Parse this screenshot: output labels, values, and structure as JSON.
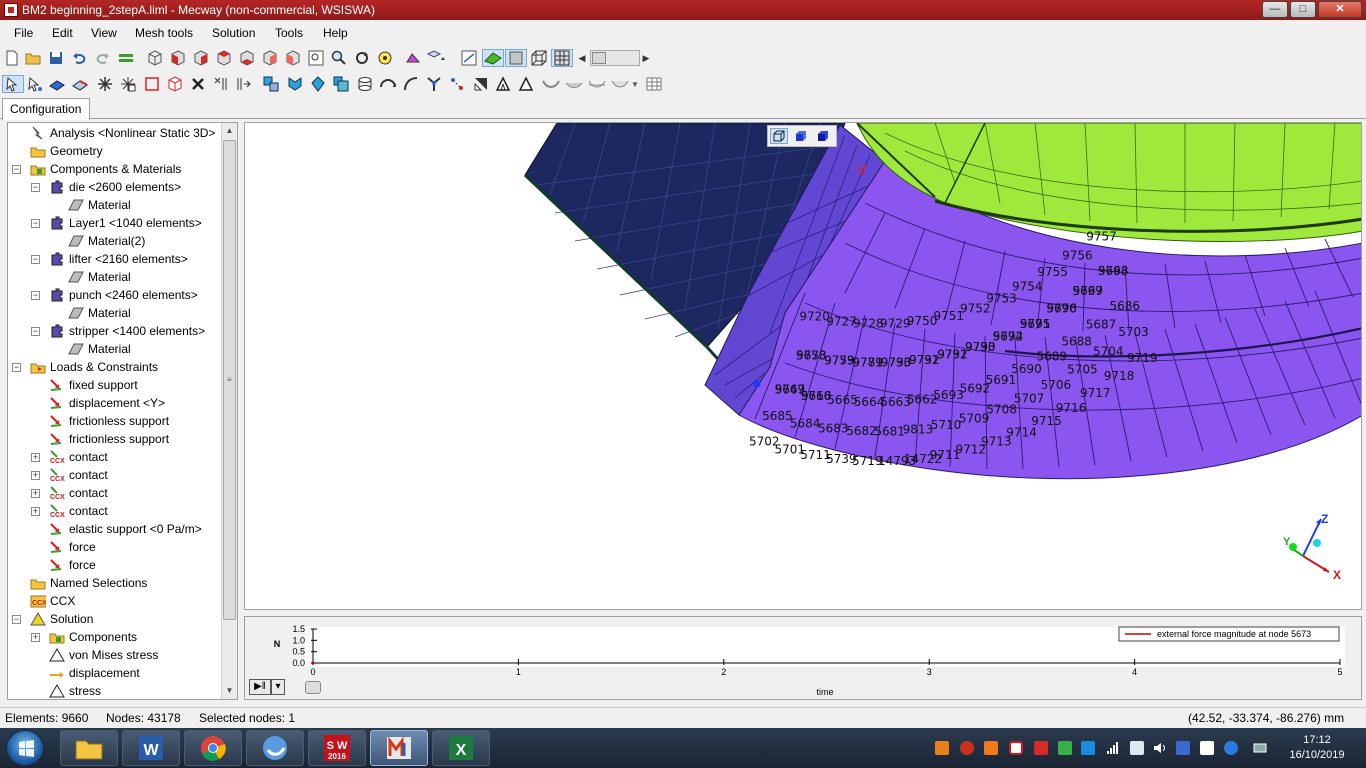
{
  "window": {
    "title": "BM2 beginning_2stepA.liml - Mecway (non-commercial, WSISWA)",
    "minimize_label": "—",
    "maximize_label": "□",
    "close_label": "✕"
  },
  "menu": [
    "File",
    "Edit",
    "View",
    "Mesh tools",
    "Solution",
    "Tools",
    "Help"
  ],
  "tabs": {
    "configuration": "Configuration"
  },
  "tree": [
    {
      "label": "Analysis <Nonlinear Static 3D>",
      "icon": "analysis-icon",
      "level": 1,
      "expander": ""
    },
    {
      "label": "Geometry",
      "icon": "folder-icon",
      "level": 1,
      "expander": ""
    },
    {
      "label": "Components & Materials",
      "icon": "components-icon",
      "level": 1,
      "expander": "-"
    },
    {
      "label": "die <2600 elements>",
      "icon": "component-icon",
      "level": 2,
      "expander": "-"
    },
    {
      "label": "Material",
      "icon": "material-icon",
      "level": 3,
      "expander": ""
    },
    {
      "label": "Layer1 <1040 elements>",
      "icon": "component-icon",
      "level": 2,
      "expander": "-"
    },
    {
      "label": "Material(2)",
      "icon": "material-icon",
      "level": 3,
      "expander": ""
    },
    {
      "label": "lifter <2160 elements>",
      "icon": "component-icon",
      "level": 2,
      "expander": "-"
    },
    {
      "label": "Material",
      "icon": "material-icon",
      "level": 3,
      "expander": ""
    },
    {
      "label": "punch <2460 elements>",
      "icon": "component-icon",
      "level": 2,
      "expander": "-"
    },
    {
      "label": "Material",
      "icon": "material-icon",
      "level": 3,
      "expander": ""
    },
    {
      "label": "stripper <1400 elements>",
      "icon": "component-icon",
      "level": 2,
      "expander": "-"
    },
    {
      "label": "Material",
      "icon": "material-icon",
      "level": 3,
      "expander": ""
    },
    {
      "label": "Loads & Constraints",
      "icon": "loads-folder-icon",
      "level": 1,
      "expander": "-"
    },
    {
      "label": "fixed support",
      "icon": "support-icon",
      "level": 2,
      "expander": ""
    },
    {
      "label": "displacement <Y>",
      "icon": "support-icon",
      "level": 2,
      "expander": ""
    },
    {
      "label": "frictionless support",
      "icon": "support-icon",
      "level": 2,
      "expander": ""
    },
    {
      "label": "frictionless support",
      "icon": "support-icon",
      "level": 2,
      "expander": ""
    },
    {
      "label": "contact",
      "icon": "ccx-contact-icon",
      "level": 2,
      "expander": "+"
    },
    {
      "label": "contact",
      "icon": "ccx-contact-icon",
      "level": 2,
      "expander": "+"
    },
    {
      "label": "contact",
      "icon": "ccx-contact-icon",
      "level": 2,
      "expander": "+"
    },
    {
      "label": "contact",
      "icon": "ccx-contact-icon",
      "level": 2,
      "expander": "+"
    },
    {
      "label": "elastic support <0 Pa/m>",
      "icon": "support-icon",
      "level": 2,
      "expander": ""
    },
    {
      "label": "force",
      "icon": "support-icon",
      "level": 2,
      "expander": ""
    },
    {
      "label": "force",
      "icon": "support-icon",
      "level": 2,
      "expander": ""
    },
    {
      "label": "Named Selections",
      "icon": "named-selections-icon",
      "level": 1,
      "expander": ""
    },
    {
      "label": "CCX",
      "icon": "ccx-icon",
      "level": 1,
      "expander": ""
    },
    {
      "label": "Solution",
      "icon": "solution-icon",
      "level": 1,
      "expander": "-"
    },
    {
      "label": "Components",
      "icon": "components-icon",
      "level": 2,
      "expander": "+"
    },
    {
      "label": "von Mises stress",
      "icon": "triangle-icon",
      "level": 2,
      "expander": ""
    },
    {
      "label": "displacement",
      "icon": "displacement-icon",
      "level": 2,
      "expander": ""
    },
    {
      "label": "stress",
      "icon": "triangle-icon",
      "level": 2,
      "expander": ""
    }
  ],
  "viewport": {
    "node_labels": [
      "5673",
      "9773",
      "9771",
      "9733",
      "9732",
      "9731",
      "9730",
      "5672",
      "5671",
      "5670",
      "5669",
      "5668",
      "5667",
      "5666",
      "5665",
      "5664",
      "5663",
      "5662",
      "5693",
      "5692",
      "5691",
      "5690",
      "5689",
      "5688",
      "5687",
      "5686",
      "5685",
      "5684",
      "5683",
      "5682",
      "5681",
      "9813",
      "5710",
      "5709",
      "5708",
      "5707",
      "5706",
      "5705",
      "5704",
      "5703",
      "5702",
      "5701",
      "5711",
      "5739",
      "5719",
      "14793",
      "14722",
      "9711",
      "9712",
      "9713",
      "9714",
      "9715",
      "9716",
      "9717",
      "9718",
      "9719",
      "9720",
      "9727",
      "9728",
      "9729",
      "9750",
      "9751",
      "9752",
      "9753",
      "9754",
      "9755",
      "9756",
      "9757",
      "9758",
      "9759",
      "9789",
      "9790",
      "9791",
      "9792",
      "9793",
      "9794",
      "9795",
      "9796",
      "9797",
      "9798",
      "9749",
      "9710"
    ],
    "view_buttons": [
      "wireframe-cube-icon",
      "solid-cube-icon",
      "shaded-cube-icon"
    ],
    "axes": {
      "z": "Z",
      "y": "Y",
      "x": "X"
    }
  },
  "chart_data": {
    "type": "line",
    "series": [
      {
        "name": "external force magnitude at node 5673",
        "x": [
          0
        ],
        "y": [
          0
        ]
      }
    ],
    "xlabel": "time",
    "ylabel": "N",
    "xlim": [
      0,
      5
    ],
    "ylim": [
      0,
      1.5
    ],
    "x_ticks": [
      "0",
      "1",
      "2",
      "3",
      "4",
      "5"
    ],
    "y_ticks": [
      "1.5",
      "1.0",
      "0.5",
      "0.0"
    ],
    "line_color": "#cc0000",
    "legend_position": "top-right"
  },
  "playback": {
    "play_pause": "▶‖",
    "dropdown": "▾"
  },
  "status": {
    "elements": "Elements: 9660",
    "nodes": "Nodes: 43178",
    "selected": "Selected nodes: 1",
    "coords": "(42.52, -33.374, -86.276) mm"
  },
  "taskbar": {
    "apps": [
      "file-explorer-icon",
      "word-icon",
      "chrome-icon",
      "app-blue-icon",
      "solidworks-icon",
      "mecway-icon",
      "excel-icon"
    ],
    "solidworks_label": "S W",
    "solidworks_year": "2016",
    "time": "17:12",
    "date": "16/10/2019"
  },
  "colors": {
    "title_red": "#a51f1f",
    "die_navy": "#1e2860",
    "lifter_purple": "#8a55ef",
    "layer_indigo": "#6145cf",
    "punch_green": "#9ce838"
  }
}
